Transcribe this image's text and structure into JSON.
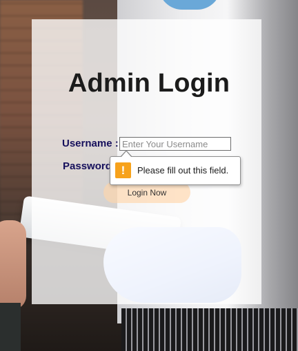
{
  "login": {
    "title": "Admin Login",
    "username_label": "Username :",
    "password_label": "Password",
    "username_value": "",
    "username_placeholder": "Enter Your Username",
    "login_button_label": "Login Now"
  },
  "validation": {
    "message": "Please fill out this field.",
    "icon": "warning-icon",
    "icon_glyph": "!",
    "icon_color": "#f7a21b"
  },
  "colors": {
    "label_color": "#16105c",
    "title_color": "#1b1b1b",
    "button_color": "#ffd6aa"
  }
}
